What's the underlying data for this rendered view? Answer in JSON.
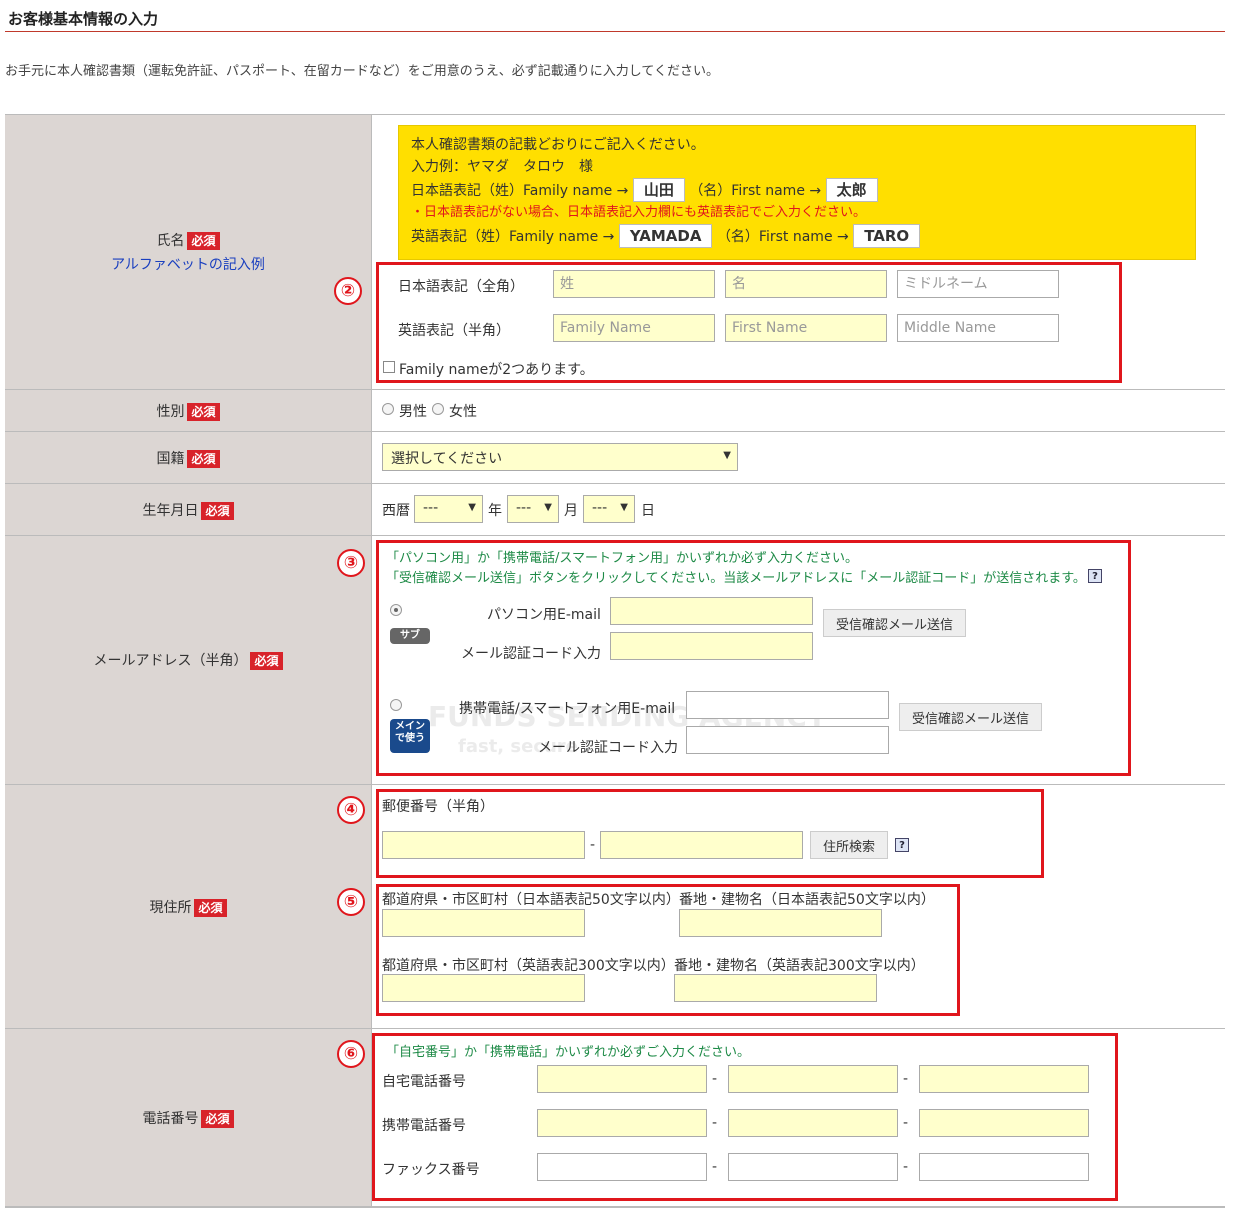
{
  "header": {
    "title": "お客様基本情報の入力",
    "intro": "お手元に本人確認書類（運転免許証、パスポート、在留カードなど）をご用意のうえ、必ず記載通りに入力してください。"
  },
  "required_badge": "必須",
  "name_section": {
    "label": "氏名",
    "example_link": "アルファベットの記入例",
    "notice_line1": "本人確認書類の記載どおりにご記入ください。",
    "notice_line2": "入力例：ヤマダ　タロウ　様",
    "jp_prefix": "日本語表記（姓）Family name →",
    "jp_family": "山田",
    "jp_mid": "（名）First name →",
    "jp_first": "太郎",
    "notice_red": "・日本語表記がない場合、日本語表記入力欄にも英語表記でご入力ください。",
    "en_prefix": "英語表記（姓）Family name →",
    "en_family": "YAMADA",
    "en_mid": "（名）First name →",
    "en_first": "TARO",
    "marker": "②",
    "jp_row_label": "日本語表記（全角）",
    "jp_ph_family": "姓",
    "jp_ph_first": "名",
    "jp_ph_middle": "ミドルネーム",
    "en_row_label": "英語表記（半角）",
    "en_ph_family": "Family Name",
    "en_ph_first": "First Name",
    "en_ph_middle": "Middle Name",
    "two_family_checkbox": "Family nameが2つあります。"
  },
  "gender": {
    "label": "性別",
    "male": "男性",
    "female": "女性"
  },
  "nationality": {
    "label": "国籍",
    "selected": "選択してください"
  },
  "birthday": {
    "label": "生年月日",
    "era": "西暦",
    "year_val": "---",
    "year": "年",
    "month_val": "---",
    "month": "月",
    "day_val": "---",
    "day": "日"
  },
  "email": {
    "label": "メールアドレス（半角）",
    "marker": "③",
    "note1": "「パソコン用」か「携帯電話/スマートフォン用」かいずれか必ず入力ください。",
    "note2": "「受信確認メール送信」ボタンをクリックしてください。当該メールアドレスに「メール認証コード」が送信されます。",
    "help": "?",
    "sub_badge": "サブ",
    "pc_label": "パソコン用E-mail",
    "code_label": "メール認証コード入力",
    "send_button": "受信確認メール送信",
    "main_badge_1": "メイン",
    "main_badge_2": "で使う",
    "mobile_label": "携帯電話/スマートフォン用E-mail",
    "watermark_1": "FUNDS SENDING AGENCY",
    "watermark_2": "fast, secure"
  },
  "address": {
    "label": "現住所",
    "marker_zip": "④",
    "zip_label": "郵便番号（半角）",
    "dash": "-",
    "search_button": "住所検索",
    "help": "?",
    "marker_addr": "⑤",
    "pref_jp": "都道府県・市区町村（日本語表記50文字以内）",
    "street_jp": "番地・建物名（日本語表記50文字以内）",
    "pref_en": "都道府県・市区町村（英語表記300文字以内）",
    "street_en": "番地・建物名（英語表記300文字以内）"
  },
  "phone": {
    "label": "電話番号",
    "marker": "⑥",
    "note": "「自宅番号」か「携帯電話」かいずれか必ずご入力ください。",
    "home": "自宅電話番号",
    "mobile": "携帯電話番号",
    "fax": "ファックス番号",
    "dash": "-"
  }
}
